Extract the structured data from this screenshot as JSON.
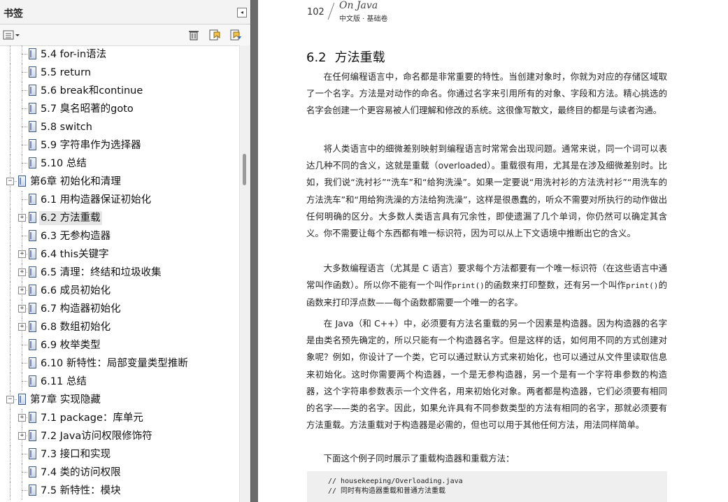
{
  "panel": {
    "title": "书签",
    "collapse_glyph": "◂",
    "toolbar": {
      "options_icon": "options-menu-icon",
      "delete_icon": "trash-icon",
      "new_bookmark_icon": "new-bookmark-icon",
      "expand_icon": "expand-bookmark-icon"
    },
    "items": [
      {
        "label": "5.4 for-in语法",
        "level": 2,
        "toggle": "",
        "selected": false
      },
      {
        "label": "5.5 return",
        "level": 2,
        "toggle": "",
        "selected": false
      },
      {
        "label": "5.6 break和continue",
        "level": 2,
        "toggle": "",
        "selected": false
      },
      {
        "label": "5.7 臭名昭著的goto",
        "level": 2,
        "toggle": "",
        "selected": false
      },
      {
        "label": "5.8 switch",
        "level": 2,
        "toggle": "",
        "selected": false
      },
      {
        "label": "5.9 字符串作为选择器",
        "level": 2,
        "toggle": "",
        "selected": false
      },
      {
        "label": "5.10 总结",
        "level": 2,
        "toggle": "",
        "selected": false
      },
      {
        "label": "第6章 初始化和清理",
        "level": 1,
        "toggle": "-",
        "selected": false
      },
      {
        "label": "6.1 用构造器保证初始化",
        "level": 2,
        "toggle": "",
        "selected": false
      },
      {
        "label": "6.2 方法重载",
        "level": 2,
        "toggle": "+",
        "selected": true
      },
      {
        "label": "6.3 无参构造器",
        "level": 2,
        "toggle": "",
        "selected": false
      },
      {
        "label": "6.4 this关键字",
        "level": 2,
        "toggle": "+",
        "selected": false
      },
      {
        "label": "6.5 清理：终结和垃圾收集",
        "level": 2,
        "toggle": "+",
        "selected": false
      },
      {
        "label": "6.6 成员初始化",
        "level": 2,
        "toggle": "+",
        "selected": false
      },
      {
        "label": "6.7 构造器初始化",
        "level": 2,
        "toggle": "+",
        "selected": false
      },
      {
        "label": "6.8 数组初始化",
        "level": 2,
        "toggle": "+",
        "selected": false
      },
      {
        "label": "6.9 枚举类型",
        "level": 2,
        "toggle": "",
        "selected": false
      },
      {
        "label": "6.10 新特性：局部变量类型推断",
        "level": 2,
        "toggle": "",
        "selected": false
      },
      {
        "label": "6.11 总结",
        "level": 2,
        "toggle": "",
        "selected": false
      },
      {
        "label": "第7章 实现隐藏",
        "level": 1,
        "toggle": "-",
        "selected": false
      },
      {
        "label": "7.1 package：库单元",
        "level": 2,
        "toggle": "+",
        "selected": false
      },
      {
        "label": "7.2 Java访问权限修饰符",
        "level": 2,
        "toggle": "+",
        "selected": false
      },
      {
        "label": "7.3 接口和实现",
        "level": 2,
        "toggle": "",
        "selected": false
      },
      {
        "label": "7.4 类的访问权限",
        "level": 2,
        "toggle": "",
        "selected": false
      },
      {
        "label": "7.5 新特性：模块",
        "level": 2,
        "toggle": "",
        "selected": false
      }
    ]
  },
  "page": {
    "page_number": "102",
    "brand": "On Java",
    "subtitle": "中文版 · 基础卷",
    "section_number": "6.2",
    "section_title": "方法重载",
    "p1": "在任何编程语言中，命名都是非常重要的特性。当创建对象时，你就为对应的存储区域取了一个名字。方法是对动作的命名。你通过名字来引用所有的对象、字段和方法。精心挑选的名字会创建一个更容易被人们理解和修改的系统。这很像写散文，最终目的都是与读者沟通。",
    "p2": "将人类语言中的细微差别映射到编程语言时常常会出现问题。通常来说，同一个词可以表达几种不同的含义，这就是重载（overloaded）。重载很有用，尤其是在涉及细微差别时。比如，我们说“洗衬衫”“洗车”和“给狗洗澡”。如果一定要说“用洗衬衫的方法洗衬衫”“用洗车的方法洗车”和“用给狗洗澡的方法给狗洗澡”，这样是很愚蠢的，听众不需要对所执行的动作做出任何明确的区分。大多数人类语言具有冗余性，即使遗漏了几个单词，你仍然可以确定其含义。你不需要让每个东西都有唯一标识符，因为可以从上下文语境中推断出它的含义。",
    "p3_a": "大多数编程语言（尤其是 C 语言）要求每个方法都要有一个唯一标识符（在这些语言中通常叫作函数）。所以你不能有一个叫作",
    "p3_code1": "print()",
    "p3_b": "的函数来打印整数，还有另一个叫作",
    "p3_code2": "print()",
    "p3_c": "的函数来打印浮点数——每个函数都需要一个唯一的名字。",
    "p4": "在 Java（和 C++）中，必须要有方法名重载的另一个因素是构造器。因为构造器的名字是由类名预先确定的，所以只能有一个构造器名字。但是这样的话，如何用不同的方式创建对象呢？例如，你设计了一个类，它可以通过默认方式来初始化，也可以通过从文件里读取信息来初始化。这时你需要两个构造器，一个是无参构造器，另一个是有一个字符串参数的构造器，这个字符串参数表示一个文件名，用来初始化对象。两者都是构造器，它们必须要有相同的名字——类的名字。因此，如果允许具有不同参数类型的方法有相同的名字，那就必须要有方法重载。方法重载对于构造器是必需的，但也可以用于其他任何方法，用法同样简单。",
    "p5": "下面这个例子同时展示了重载构造器和重载方法：",
    "code": [
      "// housekeeping/Overloading.java",
      "// 同时有构造器重载和普通方法重载"
    ]
  }
}
